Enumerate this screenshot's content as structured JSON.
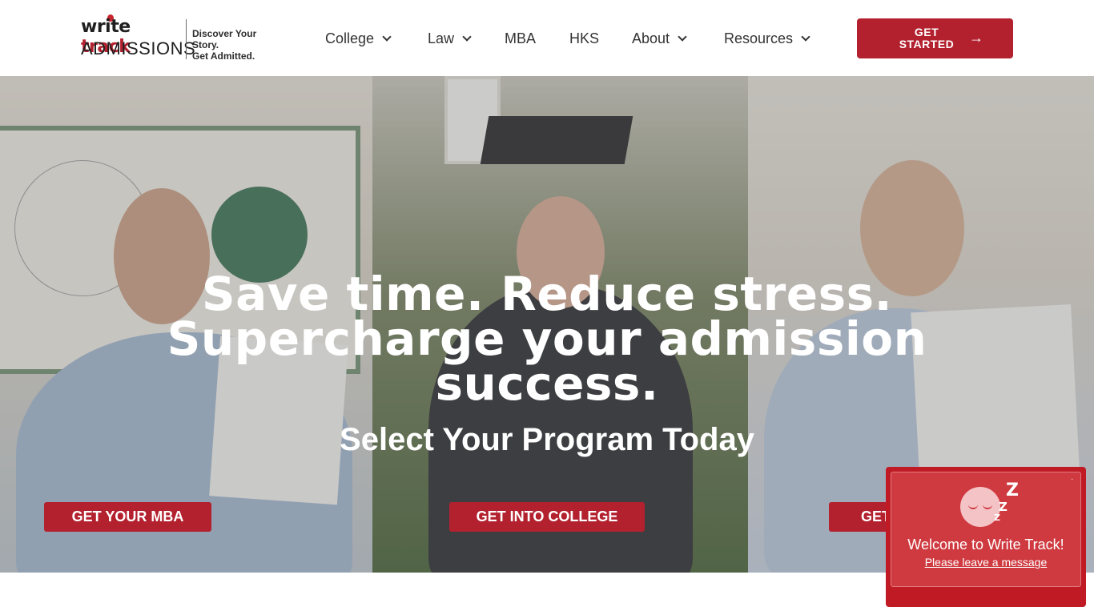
{
  "brand": {
    "logo_word_write": "write",
    "logo_word_track": "track",
    "logo_word_admissions": "ADMISSIONS",
    "tagline_line1": "Discover Your Story.",
    "tagline_line2": "Get Admitted.",
    "accent_color": "#b3212f"
  },
  "nav": {
    "items": [
      {
        "label": "College",
        "has_dropdown": true
      },
      {
        "label": "Law",
        "has_dropdown": true
      },
      {
        "label": "MBA",
        "has_dropdown": false
      },
      {
        "label": "HKS",
        "has_dropdown": false
      },
      {
        "label": "About",
        "has_dropdown": true
      },
      {
        "label": "Resources",
        "has_dropdown": true
      }
    ],
    "cta_label": "GET STARTED",
    "cta_icon": "arrow-right-icon"
  },
  "hero": {
    "headline": "Save time. Reduce stress. Supercharge your admission success.",
    "subheadline": "Select Your Program Today",
    "buttons": {
      "mba": "GET YOUR MBA",
      "college": "GET INTO COLLEGE",
      "law": "GET"
    }
  },
  "chat": {
    "close_icon": "close-icon",
    "avatar_icon": "sleeping-face-icon",
    "title": "Welcome to Write Track!",
    "link": "Please leave a message",
    "color": "#c01a24"
  }
}
